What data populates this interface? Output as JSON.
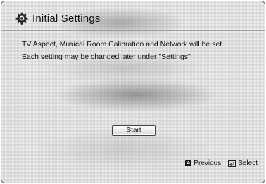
{
  "dialog": {
    "title": "Initial Settings",
    "title_icon": "gear-icon",
    "message_lines": [
      "TV Aspect, Musical Room Calibration and Network will be set.",
      "Each setting may be changed later under \"Settings\""
    ],
    "start_button_label": "Start"
  },
  "footer": {
    "previous": {
      "key_glyph": "A",
      "icon": "a-key-icon",
      "label": "Previous"
    },
    "select": {
      "icon": "enter-icon",
      "label": "Select"
    }
  },
  "colors": {
    "background": "#ececec",
    "border": "#6a6a6a",
    "text": "#111111"
  }
}
